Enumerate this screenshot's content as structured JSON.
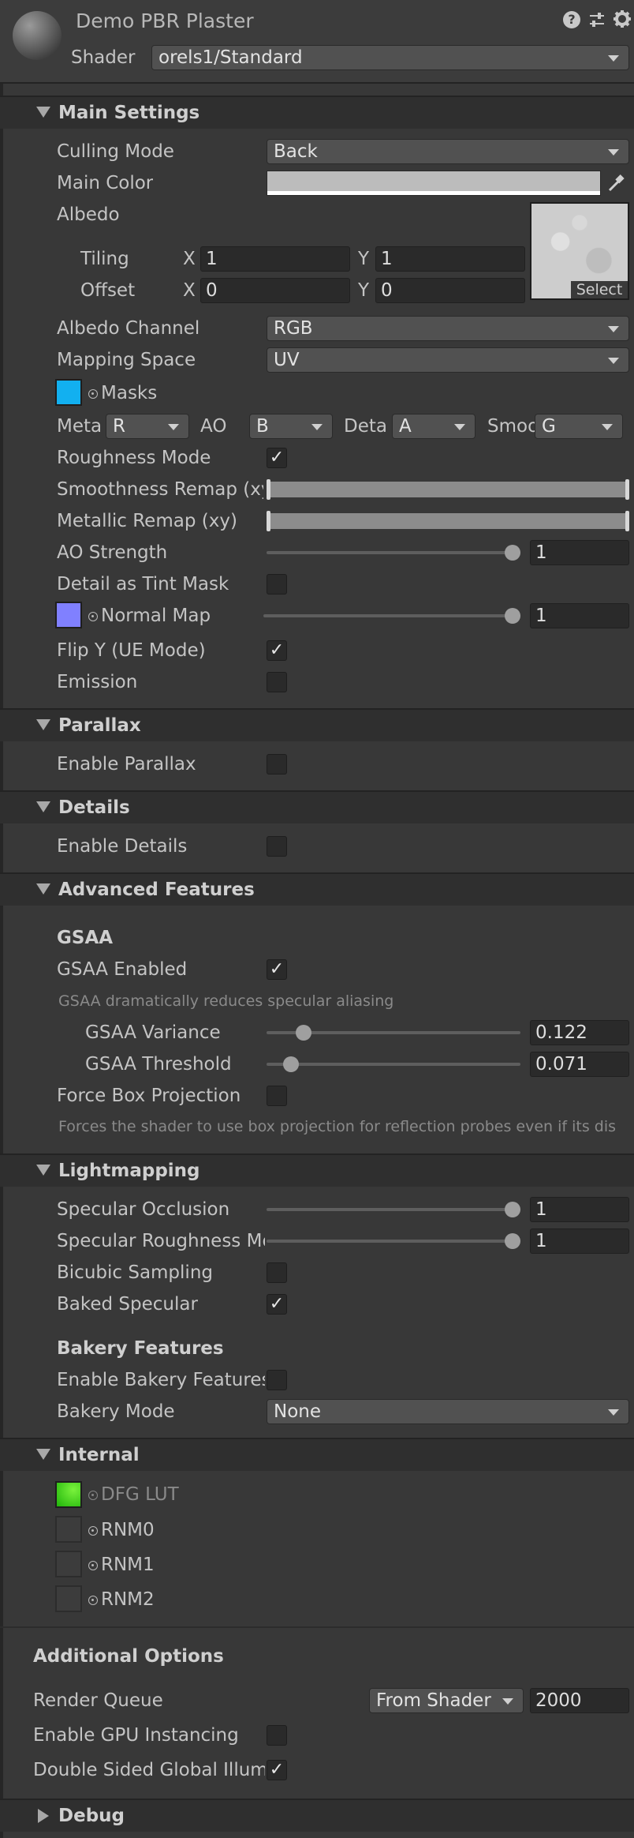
{
  "header": {
    "material_name": "Demo PBR Plaster",
    "shader_label": "Shader",
    "shader_value": "orels1/Standard"
  },
  "main": {
    "title": "Main Settings",
    "culling_label": "Culling Mode",
    "culling_value": "Back",
    "main_color_label": "Main Color",
    "albedo_label": "Albedo",
    "tiling_label": "Tiling",
    "offset_label": "Offset",
    "x_label": "X",
    "y_label": "Y",
    "tiling_x": "1",
    "tiling_y": "1",
    "offset_x": "0",
    "offset_y": "0",
    "select_label": "Select",
    "albedo_channel_label": "Albedo Channel",
    "albedo_channel_value": "RGB",
    "mapping_space_label": "Mapping Space",
    "mapping_space_value": "UV",
    "masks_label": "Masks",
    "meta_label": "Meta",
    "meta_value": "R",
    "ao_label": "AO",
    "ao_value": "B",
    "deta_label": "Deta",
    "deta_value": "A",
    "smoo_label": "Smoo",
    "smoo_value": "G",
    "roughness_mode_label": "Roughness Mode",
    "smoothness_remap_label": "Smoothness Remap (xy)",
    "metallic_remap_label": "Metallic Remap (xy)",
    "ao_strength_label": "AO Strength",
    "ao_strength_value": "1",
    "detail_tint_label": "Detail as Tint Mask",
    "normal_map_label": "Normal Map",
    "normal_map_value": "1",
    "flip_y_label": "Flip Y (UE Mode)",
    "emission_label": "Emission"
  },
  "parallax": {
    "title": "Parallax",
    "enable_label": "Enable Parallax"
  },
  "details": {
    "title": "Details",
    "enable_label": "Enable Details"
  },
  "advanced": {
    "title": "Advanced Features",
    "gsaa_heading": "GSAA",
    "gsaa_enabled_label": "GSAA Enabled",
    "gsaa_help": "GSAA dramatically reduces specular aliasing",
    "variance_label": "GSAA Variance",
    "variance_value": "0.122",
    "threshold_label": "GSAA Threshold",
    "threshold_value": "0.071",
    "force_box_label": "Force Box Projection",
    "force_box_help": "Forces the shader to use box projection for reflection probes even if its dis"
  },
  "lightmapping": {
    "title": "Lightmapping",
    "spec_occ_label": "Specular Occlusion",
    "spec_occ_value": "1",
    "spec_rough_label": "Specular Roughness Mod",
    "spec_rough_value": "1",
    "bicubic_label": "Bicubic Sampling",
    "baked_spec_label": "Baked Specular",
    "bakery_heading": "Bakery Features",
    "enable_bakery_label": "Enable Bakery Features",
    "bakery_mode_label": "Bakery Mode",
    "bakery_mode_value": "None"
  },
  "internal": {
    "title": "Internal",
    "dfg_label": "DFG LUT",
    "rnm0_label": "RNM0",
    "rnm1_label": "RNM1",
    "rnm2_label": "RNM2"
  },
  "additional": {
    "title": "Additional Options",
    "render_queue_label": "Render Queue",
    "render_queue_mode": "From Shader",
    "render_queue_value": "2000",
    "gpu_instancing_label": "Enable GPU Instancing",
    "double_sided_label": "Double Sided Global Illumi"
  },
  "debug": {
    "title": "Debug"
  },
  "values": {
    "ao_strength": 1,
    "normal_strength": 1,
    "gsaa_variance": 0.122,
    "gsaa_threshold": 0.071,
    "specular_occlusion": 1,
    "specular_roughness": 1
  },
  "colors": {
    "main_color": "#bcbcbc",
    "masks_swatch": "#12b0f0",
    "normal_swatch": "#8080ff",
    "dfg_swatch": "#37d614"
  }
}
